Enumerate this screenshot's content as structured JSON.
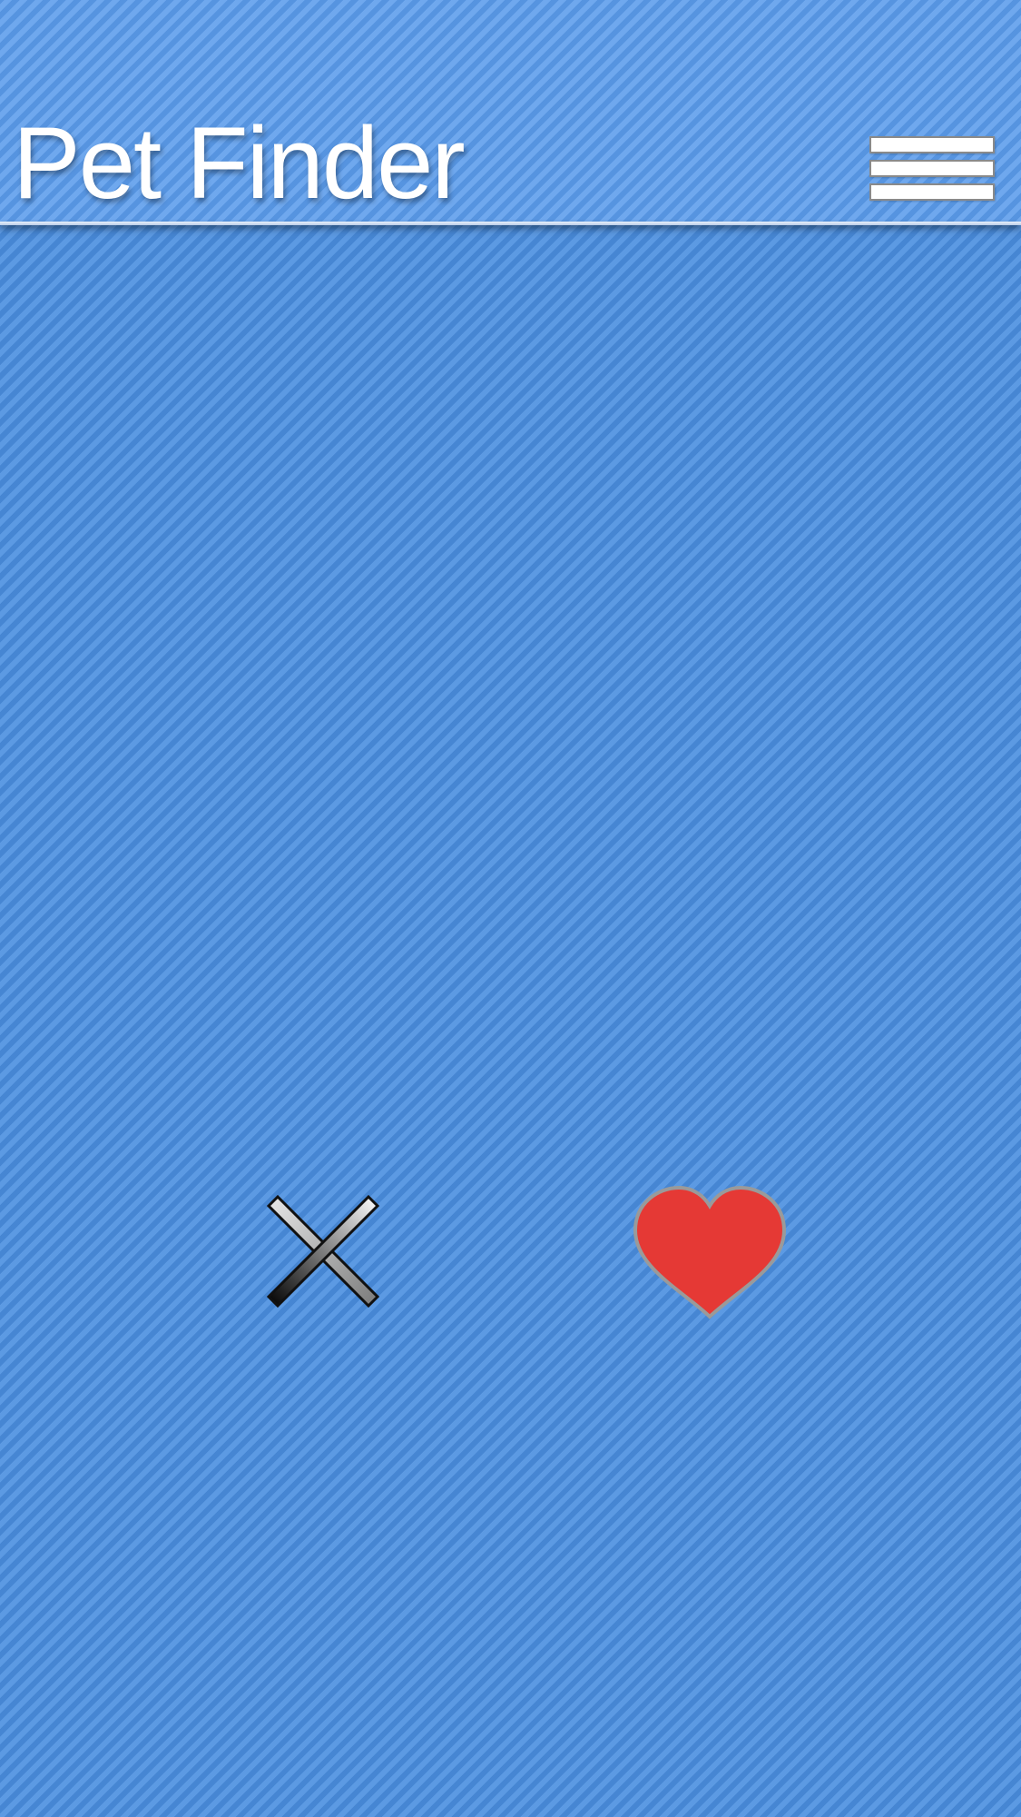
{
  "header": {
    "title": "Pet Finder",
    "menu_icon": "hamburger-menu-icon"
  },
  "actions": {
    "dismiss_icon": "close-icon",
    "like_icon": "heart-icon"
  },
  "colors": {
    "background": "#4a8ee0",
    "header_background": "#5b9cec",
    "title_text": "#ffffff",
    "heart_fill": "#e53935",
    "heart_stroke": "#9a9a9a"
  }
}
